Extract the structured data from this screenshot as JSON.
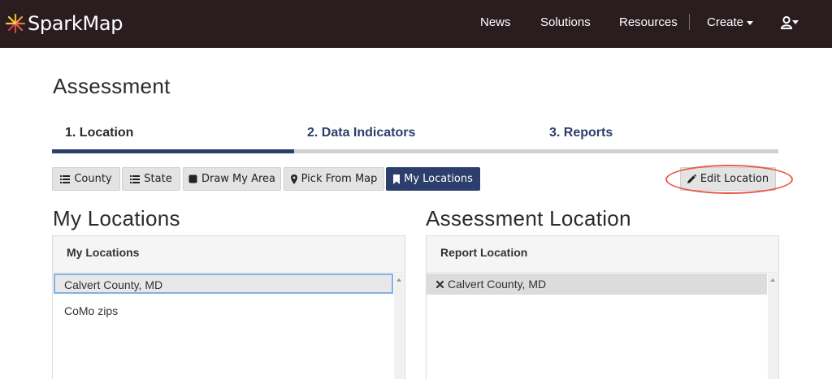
{
  "header": {
    "logo_text": "SparkMap",
    "nav": {
      "news": "News",
      "solutions": "Solutions",
      "resources": "Resources",
      "create": "Create"
    }
  },
  "page": {
    "title": "Assessment"
  },
  "steps": {
    "location": "1. Location",
    "indicators": "2. Data Indicators",
    "reports": "3. Reports",
    "progress_fraction": 0.333
  },
  "toolbar": {
    "county": "County",
    "state": "State",
    "draw": "Draw My Area",
    "pick": "Pick From Map",
    "my_locations": "My Locations",
    "edit": "Edit Location"
  },
  "left_section": {
    "title": "My Locations",
    "panel_header": "My Locations",
    "items": [
      "Calvert County, MD",
      "CoMo zips"
    ]
  },
  "right_section": {
    "title": "Assessment Location",
    "panel_header": "Report Location",
    "items": [
      "Calvert County, MD"
    ]
  },
  "colors": {
    "topbar": "#2a1d20",
    "accent": "#2c3e6b",
    "highlight": "#e65a4b"
  }
}
